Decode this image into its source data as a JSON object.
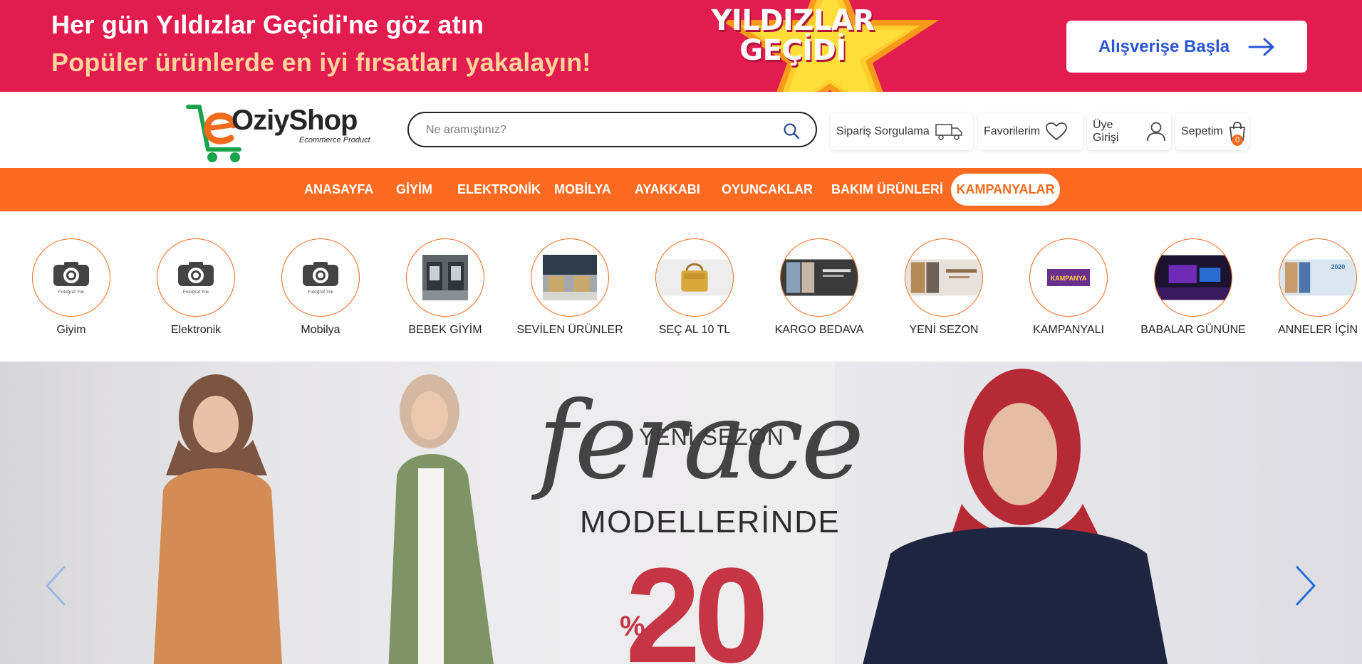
{
  "promo": {
    "line1": "Her gün Yıldızlar Geçidi'ne göz atın",
    "line2": "Popüler ürünlerde en iyi fırsatları yakalayın!",
    "badge_line1": "YILDIZLAR",
    "badge_line2": "GEÇİDİ",
    "cta_label": "Alışverişe Başla",
    "colors": {
      "background": "#e31c4f",
      "accent_text": "#ffd59a",
      "cta_text": "#2a56d6"
    }
  },
  "header": {
    "logo_text": "OziyShop",
    "logo_sub": "Ecommerce Product",
    "search_placeholder": "Ne aramıştınız?",
    "order_tracking": "Sipariş Sorgulama",
    "favorites": "Favorilerim",
    "login": "Üye Girişi",
    "cart": "Sepetim",
    "cart_count": "0"
  },
  "nav": {
    "items": [
      "ANASAYFA",
      "GİYİM",
      "ELEKTRONİK",
      "MOBİLYA",
      "AYAKKABI",
      "OYUNCAKLAR",
      "BAKIM ÜRÜNLERİ"
    ],
    "active": "KAMPANYALAR",
    "color": "#fd6a21"
  },
  "categories": [
    {
      "label": "Giyim",
      "image": "camera-placeholder-icon",
      "placeholder_text": "Fotoğraf Yok"
    },
    {
      "label": "Elektronik",
      "image": "camera-placeholder-icon",
      "placeholder_text": "Fotoğraf Yok"
    },
    {
      "label": "Mobilya",
      "image": "camera-placeholder-icon",
      "placeholder_text": "Fotoğraf Yok"
    },
    {
      "label": "BEBEK GİYİM",
      "image": "store-photo"
    },
    {
      "label": "SEVİLEN ÜRÜNLER",
      "image": "chairs-photo"
    },
    {
      "label": "SEÇ AL 10 TL",
      "image": "handbag-photo"
    },
    {
      "label": "KARGO BEDAVA",
      "image": "banner-photo"
    },
    {
      "label": "YENİ SEZON",
      "image": "banner-photo"
    },
    {
      "label": "KAMPANYALI",
      "image": "kampanya-banner",
      "banner_text": "KAMPANYA"
    },
    {
      "label": "BABALAR GÜNÜNE",
      "image": "tech-banner"
    },
    {
      "label": "ANNELER İÇİN",
      "image": "banner-photo",
      "banner_text": "2020"
    }
  ],
  "hero": {
    "line_top": "YENİ SEZON",
    "script": "ferace",
    "line_mid": "MODELLERİNDE",
    "pct_symbol": "%",
    "discount": "20",
    "accent": "#c53544"
  }
}
